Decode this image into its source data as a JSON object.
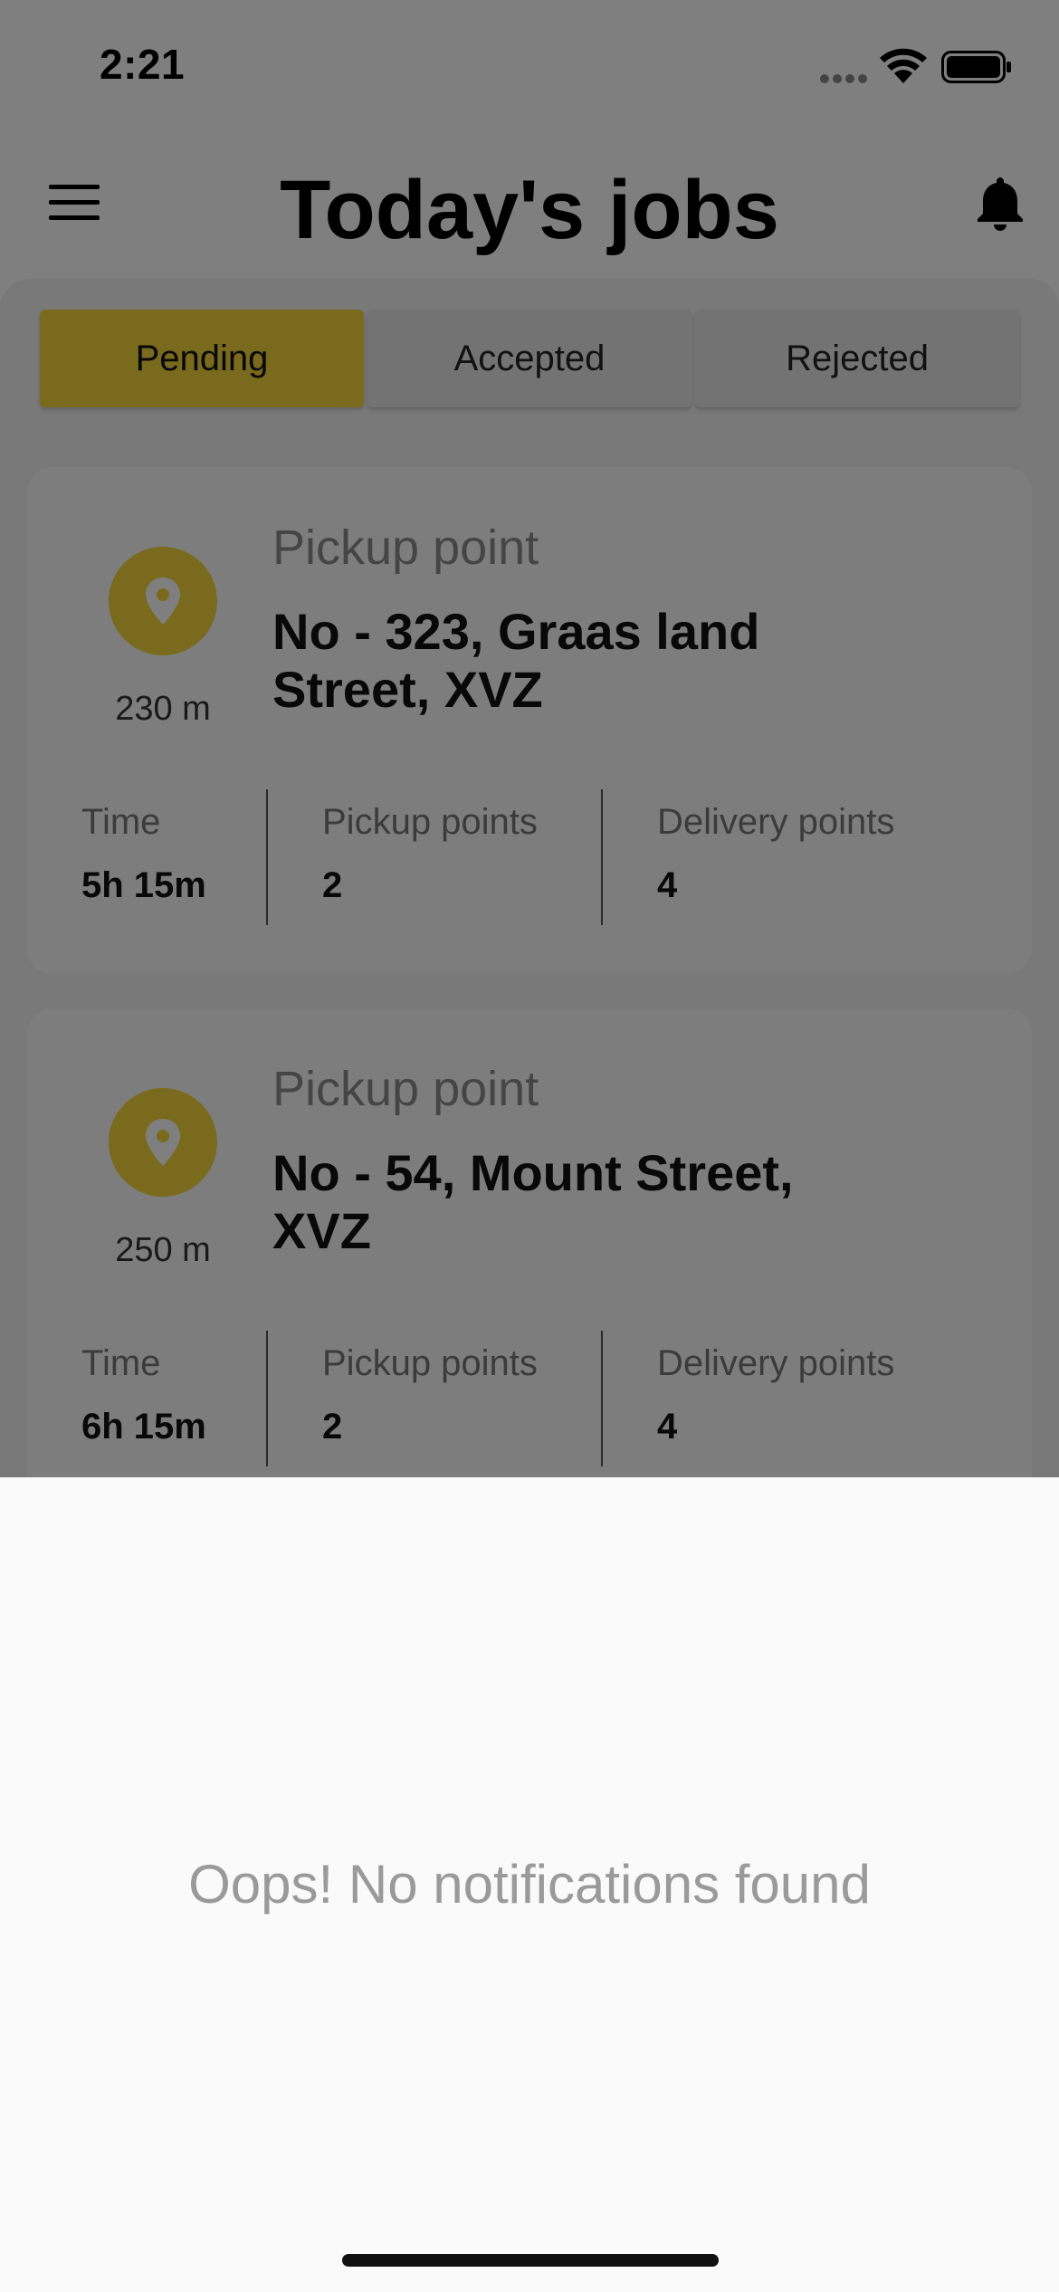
{
  "status_bar": {
    "time": "2:21"
  },
  "header": {
    "title": "Today's jobs",
    "menu_icon": "menu-icon",
    "bell_icon": "bell-icon"
  },
  "tabs": [
    {
      "label": "Pending",
      "active": true
    },
    {
      "label": "Accepted",
      "active": false
    },
    {
      "label": "Rejected",
      "active": false
    }
  ],
  "jobs": [
    {
      "distance": "230 m",
      "pickup_label": "Pickup point",
      "address_line1": "No - 323, Graas land",
      "address_line2": "Street, XVZ",
      "stats": {
        "time_label": "Time",
        "time_value": "5h 15m",
        "pickup_label": "Pickup points",
        "pickup_value": "2",
        "delivery_label": "Delivery points",
        "delivery_value": "4"
      }
    },
    {
      "distance": "250 m",
      "pickup_label": "Pickup point",
      "address_line1": "No - 54, Mount Street,",
      "address_line2": "XVZ",
      "stats": {
        "time_label": "Time",
        "time_value": "6h 15m",
        "pickup_label": "Pickup points",
        "pickup_value": "2",
        "delivery_label": "Delivery points",
        "delivery_value": "4"
      }
    }
  ],
  "notifications_sheet": {
    "empty_message": "Oops! No notifications found"
  },
  "colors": {
    "accent": "#f3d43b",
    "overlay": "rgba(0,0,0,0.5)",
    "sheet_background": "#fafafa"
  }
}
